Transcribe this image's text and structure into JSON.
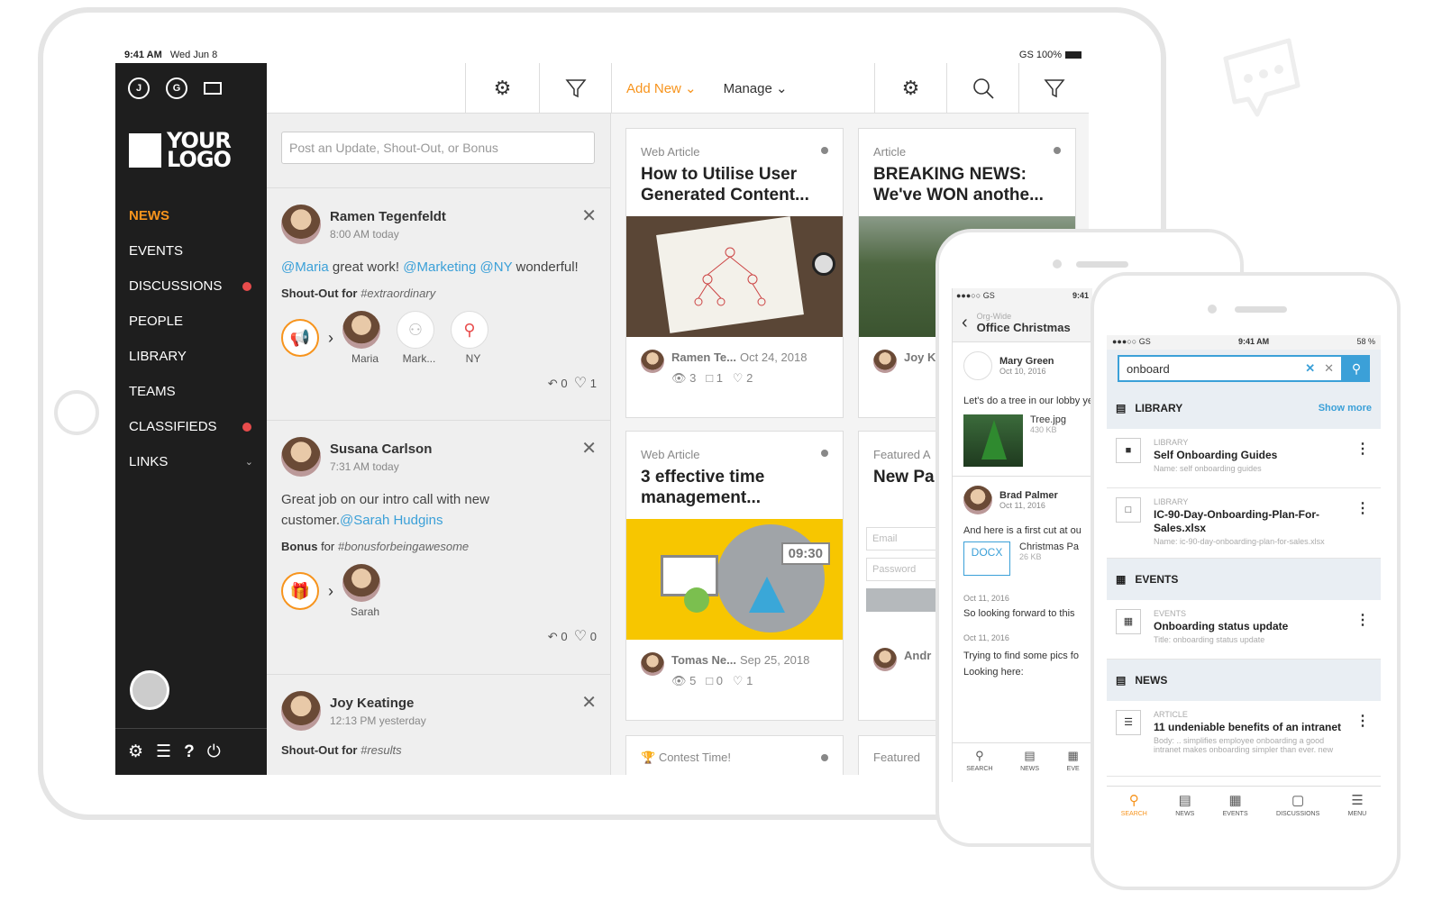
{
  "tablet": {
    "status_time": "9:41 AM",
    "status_date": "Wed Jun 8",
    "status_right": "GS 100%"
  },
  "sidebar": {
    "icon_j": "J",
    "icon_g": "G",
    "logo_text": "YOUR LOGO",
    "items": [
      {
        "label": "NEWS"
      },
      {
        "label": "EVENTS"
      },
      {
        "label": "DISCUSSIONS"
      },
      {
        "label": "PEOPLE"
      },
      {
        "label": "LIBRARY"
      },
      {
        "label": "TEAMS"
      },
      {
        "label": "CLASSIFIEDS"
      },
      {
        "label": "LINKS"
      }
    ]
  },
  "toolbar": {
    "add_new": "Add New",
    "manage": "Manage"
  },
  "feed": {
    "post_placeholder": "Post an Update, Shout-Out, or Bonus",
    "items": [
      {
        "name": "Ramen Tegenfeldt",
        "time": "8:00 AM today",
        "mention1": "@Maria",
        "text1": " great work! ",
        "mention2": "@Marketing",
        "mention3": "@NY",
        "text2": " wonderful!",
        "tag_label": "Shout-Out for",
        "tag_value": "#extraordinary",
        "recipients": [
          "Maria",
          "Mark...",
          "NY"
        ],
        "replies": "0",
        "likes": "1"
      },
      {
        "name": "Susana Carlson",
        "time": "7:31 AM today",
        "text1": "Great job on our intro call with new customer.",
        "mention1": "@Sarah Hudgins",
        "tag_label": "Bonus",
        "tag_value": "#bonusforbeingawesome",
        "recipients": [
          "Sarah"
        ],
        "replies": "0",
        "likes": "0"
      },
      {
        "name": "Joy Keatinge",
        "time": "12:13 PM yesterday",
        "tag_label": "Shout-Out for",
        "tag_value": "#results"
      }
    ]
  },
  "cards": [
    {
      "type": "Web Article",
      "title": "How to Utilise User Generated Content...",
      "author": "Ramen Te...",
      "date": "Oct 24, 2018",
      "views": "3",
      "comments": "1",
      "likes": "2"
    },
    {
      "type": "Article",
      "title": "BREAKING NEWS: We've WON anothe...",
      "author": "Joy K"
    },
    {
      "type": "Web Article",
      "title": "3 effective time management...",
      "author": "Tomas Ne...",
      "date": "Sep 25, 2018",
      "views": "5",
      "comments": "0",
      "likes": "1",
      "clock": "09:30"
    },
    {
      "type": "Featured A",
      "title": "New Pa",
      "email_ph": "Email",
      "password_ph": "Password",
      "author": "Andr"
    },
    {
      "type": "Contest Time!"
    },
    {
      "type": "Featured"
    }
  ],
  "phone1": {
    "status_left": "GS",
    "status_time": "9:41",
    "org": "Org-Wide",
    "title": "Office Christmas",
    "p1_name": "Mary Green",
    "p1_date": "Oct 10, 2016",
    "p1_text": "Let's do a tree in our lobby year's.",
    "file1": "Tree.jpg",
    "file1_size": "430 KB",
    "p2_name": "Brad Palmer",
    "p2_date": "Oct 11, 2016",
    "p2_text": "And here is a first cut at ou",
    "docx": "DOCX",
    "file2": "Christmas Pa",
    "file2_size": "26 KB",
    "p3_date": "Oct 11, 2016",
    "p3_text": "So looking forward to this",
    "p4_date": "Oct 11, 2016",
    "p4_text": "Trying to find some pics fo Looking here:",
    "tabs": [
      "SEARCH",
      "NEWS",
      "EVE"
    ]
  },
  "phone2": {
    "status_left": "GS",
    "status_time": "9:41 AM",
    "status_right": "58 %",
    "search_value": "onboard",
    "sections": {
      "library": "LIBRARY",
      "show_more": "Show more",
      "events": "EVENTS",
      "news": "NEWS"
    },
    "results": [
      {
        "cat": "LIBRARY",
        "title": "Self Onboarding Guides",
        "sub": "Name: self onboarding guides"
      },
      {
        "cat": "LIBRARY",
        "title": "IC-90-Day-Onboarding-Plan-For-Sales.xlsx",
        "sub": "Name: ic-90-day-onboarding-plan-for-sales.xlsx"
      },
      {
        "cat": "EVENTS",
        "title": "Onboarding status update",
        "sub": "Title: onboarding status update"
      },
      {
        "cat": "ARTICLE",
        "title": "11 undeniable benefits of an intranet",
        "sub": "Body: .. simplifies employee onboarding a good intranet makes onboarding simpler than ever. new"
      }
    ],
    "tabs": [
      "SEARCH",
      "NEWS",
      "EVENTS",
      "DISCUSSIONS",
      "MENU"
    ]
  }
}
